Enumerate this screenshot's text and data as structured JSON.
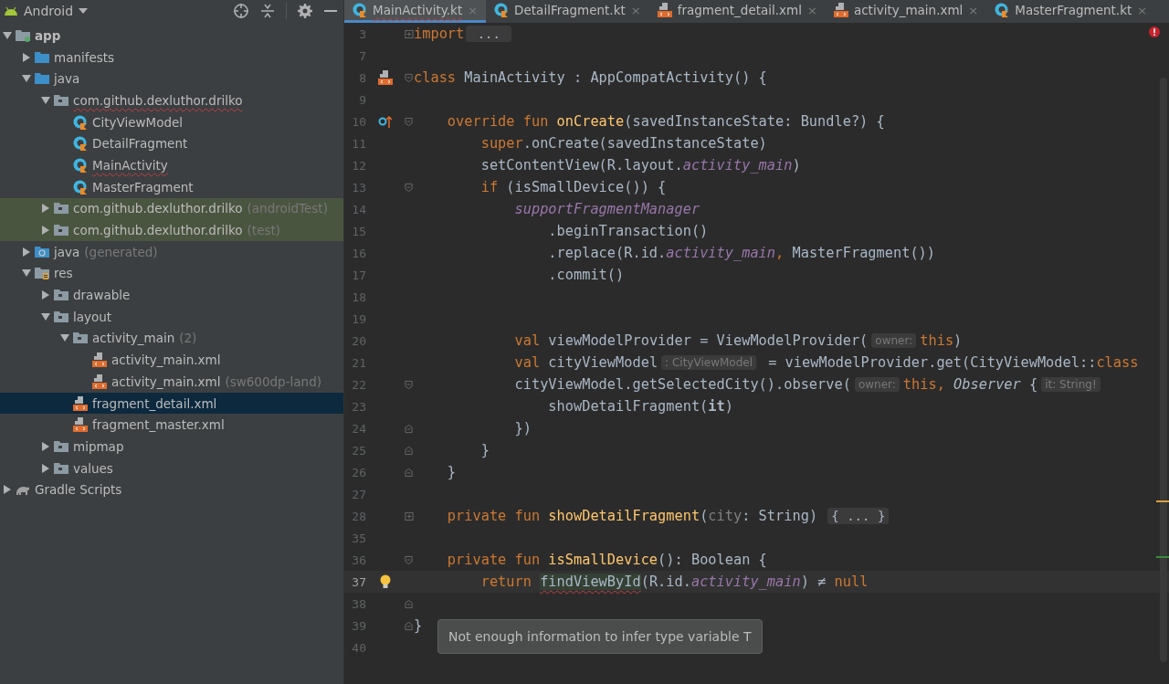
{
  "project_panel": {
    "view": "Android",
    "tree": [
      {
        "label": "app",
        "kind": "module",
        "expanded": true,
        "selected": false,
        "highlighted": false,
        "error": false,
        "children": [
          {
            "label": "manifests",
            "kind": "folder",
            "expanded": false,
            "selected": false,
            "highlighted": false,
            "error": false
          },
          {
            "label": "java",
            "kind": "folder",
            "expanded": true,
            "selected": false,
            "highlighted": false,
            "error": false,
            "children": [
              {
                "label": "com.github.dexluthor.drilko",
                "kind": "package",
                "expanded": true,
                "selected": false,
                "highlighted": false,
                "error": true,
                "children": [
                  {
                    "label": "CityViewModel",
                    "kind": "kotlin",
                    "selected": false,
                    "highlighted": false,
                    "error": false
                  },
                  {
                    "label": "DetailFragment",
                    "kind": "kotlin",
                    "selected": false,
                    "highlighted": false,
                    "error": false
                  },
                  {
                    "label": "MainActivity",
                    "kind": "kotlin",
                    "selected": false,
                    "highlighted": false,
                    "error": true
                  },
                  {
                    "label": "MasterFragment",
                    "kind": "kotlin",
                    "selected": false,
                    "highlighted": false,
                    "error": false
                  }
                ]
              },
              {
                "label": "com.github.dexluthor.drilko",
                "suffix": "(androidTest)",
                "kind": "package",
                "expanded": false,
                "selected": false,
                "highlighted": true,
                "error": false
              },
              {
                "label": "com.github.dexluthor.drilko",
                "suffix": "(test)",
                "kind": "package",
                "expanded": false,
                "selected": false,
                "highlighted": true,
                "error": false
              }
            ]
          },
          {
            "label": "java",
            "suffix": "(generated)",
            "kind": "generated",
            "expanded": false,
            "selected": false,
            "highlighted": false,
            "error": false
          },
          {
            "label": "res",
            "kind": "res",
            "expanded": true,
            "selected": false,
            "highlighted": false,
            "error": false,
            "children": [
              {
                "label": "drawable",
                "kind": "package",
                "expanded": false,
                "selected": false,
                "highlighted": false,
                "error": false
              },
              {
                "label": "layout",
                "kind": "package",
                "expanded": true,
                "selected": false,
                "highlighted": false,
                "error": false,
                "children": [
                  {
                    "label": "activity_main",
                    "suffix": "(2)",
                    "kind": "package",
                    "expanded": true,
                    "selected": false,
                    "highlighted": false,
                    "error": false,
                    "children": [
                      {
                        "label": "activity_main.xml",
                        "kind": "layout",
                        "selected": false,
                        "highlighted": false,
                        "error": false
                      },
                      {
                        "label": "activity_main.xml",
                        "suffix": "(sw600dp-land)",
                        "kind": "layout",
                        "selected": false,
                        "highlighted": false,
                        "error": false
                      }
                    ]
                  },
                  {
                    "label": "fragment_detail.xml",
                    "kind": "layout",
                    "selected": true,
                    "error": false
                  },
                  {
                    "label": "fragment_master.xml",
                    "kind": "layout",
                    "selected": false,
                    "highlighted": false,
                    "error": false
                  }
                ]
              },
              {
                "label": "mipmap",
                "kind": "package",
                "expanded": false,
                "selected": false,
                "highlighted": false,
                "error": false
              },
              {
                "label": "values",
                "kind": "package",
                "expanded": false,
                "selected": false,
                "highlighted": false,
                "error": false
              }
            ]
          }
        ]
      },
      {
        "label": "Gradle Scripts",
        "kind": "gradle",
        "expanded": false,
        "selected": false,
        "highlighted": false,
        "error": false
      }
    ]
  },
  "editor_tabs": [
    {
      "label": "MainActivity.kt",
      "kind": "kotlin",
      "selected": true,
      "error": true,
      "close": "×"
    },
    {
      "label": "DetailFragment.kt",
      "kind": "kotlin",
      "selected": false,
      "error": false,
      "close": "×"
    },
    {
      "label": "fragment_detail.xml",
      "kind": "layout",
      "selected": false,
      "error": false,
      "close": "×"
    },
    {
      "label": "activity_main.xml",
      "kind": "layout",
      "selected": false,
      "error": false,
      "close": "×"
    },
    {
      "label": "MasterFragment.kt",
      "kind": "kotlin",
      "selected": false,
      "error": false,
      "close": "×"
    }
  ],
  "code_lines": [
    {
      "number": "3",
      "current": false,
      "fold": {
        "kind": "collapsed"
      },
      "tokens": [
        {
          "kind": "keyword",
          "text": "import"
        },
        {
          "kind": "folded",
          "text": " ... "
        }
      ]
    },
    {
      "number": "7",
      "current": false
    },
    {
      "number": "8",
      "current": false,
      "gutter": {
        "kind": "layout"
      },
      "fold": {
        "kind": "open"
      },
      "tokens": [
        {
          "kind": "keyword",
          "text": "class"
        },
        {
          "kind": "plain",
          "text": " MainActivity : AppCompatActivity() {"
        }
      ]
    },
    {
      "number": "9",
      "current": false
    },
    {
      "number": "10",
      "current": false,
      "gutter": {
        "kind": "override"
      },
      "fold": {
        "kind": "open"
      },
      "tokens": [
        {
          "kind": "keyword",
          "text": "    override fun "
        },
        {
          "kind": "function",
          "text": "onCreate"
        },
        {
          "kind": "plain",
          "text": "(savedInstanceState: Bundle?) {"
        }
      ]
    },
    {
      "number": "11",
      "current": false,
      "tokens": [
        {
          "kind": "keyword",
          "text": "        super"
        },
        {
          "kind": "plain",
          "text": ".onCreate(savedInstanceState)"
        }
      ]
    },
    {
      "number": "12",
      "current": false,
      "tokens": [
        {
          "kind": "plain",
          "text": "        setContentView(R.layout."
        },
        {
          "kind": "property",
          "text": "activity_main"
        },
        {
          "kind": "plain",
          "text": ")"
        }
      ]
    },
    {
      "number": "13",
      "current": false,
      "fold": {
        "kind": "open"
      },
      "tokens": [
        {
          "kind": "keyword",
          "text": "        if"
        },
        {
          "kind": "plain",
          "text": " (isSmallDevice()) {"
        }
      ]
    },
    {
      "number": "14",
      "current": false,
      "tokens": [
        {
          "kind": "property",
          "text": "            supportFragmentManager"
        }
      ]
    },
    {
      "number": "15",
      "current": false,
      "tokens": [
        {
          "kind": "plain",
          "text": "                .beginTransaction()"
        }
      ]
    },
    {
      "number": "16",
      "current": false,
      "tokens": [
        {
          "kind": "plain",
          "text": "                .replace(R.id."
        },
        {
          "kind": "property",
          "text": "activity_main"
        },
        {
          "kind": "keyword",
          "text": ","
        },
        {
          "kind": "plain",
          "text": " MasterFragment())"
        }
      ]
    },
    {
      "number": "17",
      "current": false,
      "tokens": [
        {
          "kind": "plain",
          "text": "                .commit()"
        }
      ]
    },
    {
      "number": "18",
      "current": false
    },
    {
      "number": "19",
      "current": false
    },
    {
      "number": "20",
      "current": false,
      "tokens": [
        {
          "kind": "keyword",
          "text": "            val"
        },
        {
          "kind": "plain",
          "text": " viewModelProvider = ViewModelProvider("
        },
        {
          "kind": "hint",
          "text": "owner:"
        },
        {
          "kind": "keyword",
          "text": "this"
        },
        {
          "kind": "plain",
          "text": ")"
        }
      ]
    },
    {
      "number": "21",
      "current": false,
      "tokens": [
        {
          "kind": "keyword",
          "text": "            val"
        },
        {
          "kind": "plain",
          "text": " cityViewModel"
        },
        {
          "kind": "hint",
          "text": ": CityViewModel"
        },
        {
          "kind": "plain",
          "text": " = viewModelProvider.get(CityViewModel::"
        },
        {
          "kind": "keyword",
          "text": "class"
        }
      ]
    },
    {
      "number": "22",
      "current": false,
      "fold": {
        "kind": "open"
      },
      "tokens": [
        {
          "kind": "plain",
          "text": "            cityViewModel.getSelectedCity().observe("
        },
        {
          "kind": "hint",
          "text": "owner:"
        },
        {
          "kind": "keyword",
          "text": "this, "
        },
        {
          "kind": "italic",
          "text": "Observer"
        },
        {
          "kind": "plain",
          "text": " {"
        },
        {
          "kind": "hint",
          "text": "it: String!"
        }
      ]
    },
    {
      "number": "23",
      "current": false,
      "tokens": [
        {
          "kind": "plain",
          "text": "                showDetailFragment("
        },
        {
          "kind": "bold",
          "text": "it"
        },
        {
          "kind": "plain",
          "text": ")"
        }
      ]
    },
    {
      "number": "24",
      "current": false,
      "fold": {
        "kind": "close"
      },
      "tokens": [
        {
          "kind": "plain",
          "text": "            })"
        }
      ]
    },
    {
      "number": "25",
      "current": false,
      "fold": {
        "kind": "close"
      },
      "tokens": [
        {
          "kind": "plain",
          "text": "        }"
        }
      ]
    },
    {
      "number": "26",
      "current": false,
      "fold": {
        "kind": "close"
      },
      "tokens": [
        {
          "kind": "plain",
          "text": "    }"
        }
      ]
    },
    {
      "number": "27",
      "current": false
    },
    {
      "number": "28",
      "current": false,
      "fold": {
        "kind": "collapsed"
      },
      "tokens": [
        {
          "kind": "keyword",
          "text": "    private fun "
        },
        {
          "kind": "function",
          "text": "showDetailFragment"
        },
        {
          "kind": "plain",
          "text": "("
        },
        {
          "kind": "parameter",
          "text": "city"
        },
        {
          "kind": "plain",
          "text": ": String) "
        },
        {
          "kind": "folded",
          "text": "{ ... }"
        }
      ]
    },
    {
      "number": "35",
      "current": false
    },
    {
      "number": "36",
      "current": false,
      "fold": {
        "kind": "open"
      },
      "tokens": [
        {
          "kind": "keyword",
          "text": "    private fun "
        },
        {
          "kind": "function",
          "text": "isSmallDevice"
        },
        {
          "kind": "plain",
          "text": "(): Boolean {"
        }
      ]
    },
    {
      "number": "37",
      "current": true,
      "gutter": {
        "kind": "bulb"
      },
      "tokens": [
        {
          "kind": "keyword",
          "text": "        return "
        },
        {
          "kind": "error",
          "text": "findViewById"
        },
        {
          "kind": "plain",
          "text": "(R.id."
        },
        {
          "kind": "property",
          "text": "activity_main"
        },
        {
          "kind": "plain",
          "text": ") ≠ "
        },
        {
          "kind": "keyword",
          "text": "null"
        }
      ]
    },
    {
      "number": "38",
      "current": false,
      "fold": {
        "kind": "close"
      }
    },
    {
      "number": "39",
      "current": false,
      "fold": {
        "kind": "close"
      },
      "tokens": [
        {
          "kind": "plain",
          "text": "}"
        }
      ]
    },
    {
      "number": "40",
      "current": false
    }
  ],
  "tooltip": "Not enough information to infer type variable T"
}
